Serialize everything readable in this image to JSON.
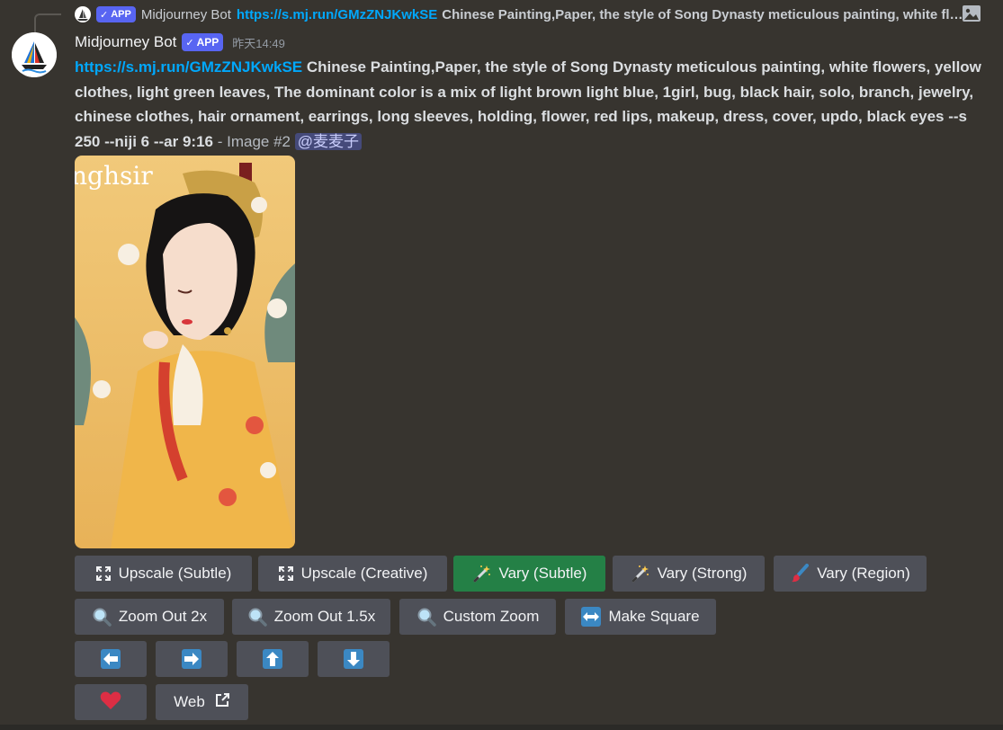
{
  "reply": {
    "author": "Midjourney Bot",
    "badge": "APP",
    "link": "https://s.mj.run/GMzZNJKwkSE",
    "text": "Chinese Painting,Paper, the style of Song Dynasty meticulous painting, white flowers, yellow clothes, light green leaves, The dominant color is a mix of light brown light blue, 1girl, bug, black hair, solo, branch, jewelry, chinese clothes, hair ornament, earrings, long sleeves, holding, flower, red lips, makeup, dress, cover, updo, black eyes --s 250 --niji 6 --ar 9:16"
  },
  "message": {
    "author": "Midjourney Bot",
    "badge": "APP",
    "timestamp": "昨天14:49",
    "link": "https://s.mj.run/GMzZNJKwkSE",
    "prompt": "Chinese Painting,Paper, the style of Song Dynasty meticulous painting, white flowers, yellow clothes, light green leaves, The dominant color is a mix of light brown light blue, 1girl, bug, black hair, solo, branch, jewelry, chinese clothes, hair ornament, earrings, long sleeves, holding, flower, red lips, makeup, dress, cover, updo, black eyes --s 250 --niji 6 --ar 9:16",
    "suffix": "- Image #2",
    "mention": "@麦麦子"
  },
  "image": {
    "title_text": "nghsir"
  },
  "buttons": {
    "upscale_subtle": "Upscale (Subtle)",
    "upscale_creative": "Upscale (Creative)",
    "vary_subtle": "Vary (Subtle)",
    "vary_strong": "Vary (Strong)",
    "vary_region": "Vary (Region)",
    "zoom_out_2x": "Zoom Out 2x",
    "zoom_out_15x": "Zoom Out 1.5x",
    "custom_zoom": "Custom Zoom",
    "make_square": "Make Square",
    "web": "Web"
  },
  "icons": {
    "upscale": "expand-arrows-icon",
    "vary": "magic-wand-icon",
    "region": "paintbrush-icon",
    "zoom": "magnifier-icon",
    "square": "left-right-arrow-icon",
    "pan": [
      "arrow-left-icon",
      "arrow-right-icon",
      "arrow-up-icon",
      "arrow-down-icon"
    ],
    "favorite": "heart-icon",
    "external": "external-link-icon"
  },
  "colors": {
    "background": "#37342f",
    "link": "#00a8fc",
    "button": "#4e5058",
    "button_active": "#248046",
    "badge": "#5865f2",
    "arrow_box": "#3b88c3",
    "heart": "#dd2e44"
  }
}
